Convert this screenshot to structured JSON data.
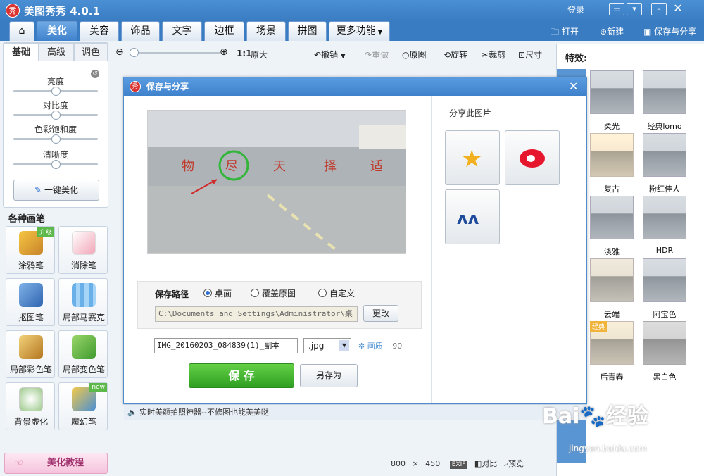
{
  "app": {
    "logo": "秀",
    "title": "美图秀秀 4.0.1",
    "login": "登录"
  },
  "window_buttons": [
    "message-icon",
    "feedback-icon",
    "minimize-icon",
    "close-icon"
  ],
  "tabs": [
    {
      "label": "home-icon",
      "active": false
    },
    {
      "label": "美化",
      "active": true
    },
    {
      "label": "美容",
      "active": false
    },
    {
      "label": "饰品",
      "active": false
    },
    {
      "label": "文字",
      "active": false
    },
    {
      "label": "边框",
      "active": false
    },
    {
      "label": "场景",
      "active": false
    },
    {
      "label": "拼图",
      "active": false
    },
    {
      "label": "更多功能",
      "active": false
    }
  ],
  "header_actions": {
    "open": "打开",
    "new": "新建",
    "save_share": "保存与分享"
  },
  "toolbar": {
    "ratio": "1:1",
    "original_size": "原大",
    "undo": "撤销",
    "redo": "重做",
    "original": "原图",
    "rotate": "旋转",
    "crop": "裁剪",
    "size": "尺寸"
  },
  "left_tabs": [
    "基础",
    "高级",
    "调色"
  ],
  "adjustments": [
    {
      "label": "亮度",
      "value": 0.5
    },
    {
      "label": "对比度",
      "value": 0.5
    },
    {
      "label": "色彩饱和度",
      "value": 0.5
    },
    {
      "label": "清晰度",
      "value": 0.5
    }
  ],
  "one_click": "一键美化",
  "brushes_title": "各种画笔",
  "brushes": [
    {
      "label": "涂鸦笔",
      "badge": "升级",
      "icon": "pencil-icon"
    },
    {
      "label": "消除笔",
      "badge": "",
      "icon": "eraser-icon"
    },
    {
      "label": "抠图笔",
      "badge": "",
      "icon": "cutout-pen-icon"
    },
    {
      "label": "局部马赛克",
      "badge": "",
      "icon": "mosaic-icon"
    },
    {
      "label": "局部彩色笔",
      "badge": "",
      "icon": "color-brush-icon"
    },
    {
      "label": "局部变色笔",
      "badge": "",
      "icon": "paint-bucket-icon"
    },
    {
      "label": "背景虚化",
      "badge": "",
      "icon": "blur-icon"
    },
    {
      "label": "魔幻笔",
      "badge": "new",
      "icon": "magic-pen-icon"
    }
  ],
  "tutorial": "美化教程",
  "effects_title": "特效:",
  "effects": [
    {
      "label": "柔光",
      "badge": ""
    },
    {
      "label": "经典lomo",
      "badge": ""
    },
    {
      "label": "复古",
      "badge": ""
    },
    {
      "label": "粉红佳人",
      "badge": ""
    },
    {
      "label": "淡雅",
      "badge": ""
    },
    {
      "label": "HDR",
      "badge": ""
    },
    {
      "label": "云端",
      "badge": ""
    },
    {
      "label": "阿宝色",
      "badge": ""
    },
    {
      "label": "后青春",
      "badge": "经典"
    },
    {
      "label": "黑白色",
      "badge": ""
    }
  ],
  "dialog": {
    "title": "保存与分享",
    "save_path_label": "保存路径",
    "radio_options": [
      "桌面",
      "覆盖原图",
      "自定义"
    ],
    "selected": 0,
    "path": "C:\\Documents and Settings\\Administrator\\桌",
    "change": "更改",
    "filename": "IMG_20160203_084839(1)_副本",
    "format": ".jpg",
    "quality_label": "画质",
    "quality": "90",
    "save": "保 存",
    "save_as": "另存为",
    "share_title": "分享此图片",
    "share_icons": [
      "qzone-icon",
      "weibo-icon",
      "renren-icon"
    ]
  },
  "status": "实时美颜拍照神器--不修图也能美美哒",
  "bottom": {
    "width": "800",
    "times": "×",
    "height": "450",
    "exif": "EXIF",
    "compare": "对比",
    "preview": "预览"
  },
  "watermark": {
    "brand": "Bai",
    "brand2": "经验",
    "url": "jingyan.baidu.com"
  },
  "colors": {
    "titlebar": "#3a7cc2",
    "save_button": "#3fb12f",
    "accent": "#2a6fd0"
  }
}
